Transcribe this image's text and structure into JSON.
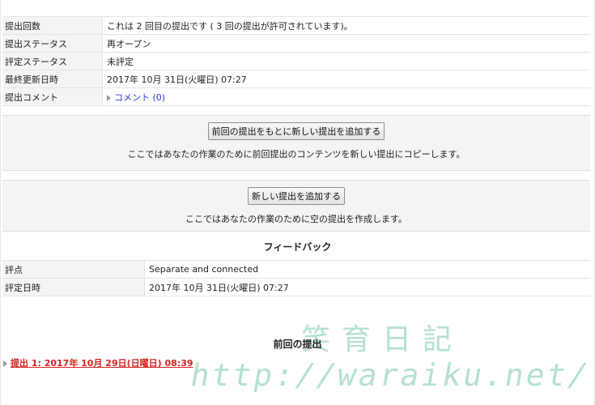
{
  "status_table": {
    "rows": [
      {
        "label": "提出回数",
        "value": "これは 2 回目の提出です ( 3 回の提出が許可されています)。"
      },
      {
        "label": "提出ステータス",
        "value": "再オープン"
      },
      {
        "label": "評定ステータス",
        "value": "未評定"
      },
      {
        "label": "最終更新日時",
        "value": "2017年 10月 31日(火曜日) 07:27"
      },
      {
        "label": "提出コメント",
        "value": "コメント (0)"
      }
    ]
  },
  "actions": {
    "copy_previous": {
      "button": "前回の提出をもとに新しい提出を追加する",
      "description": "ここではあなたの作業のために前回提出のコンテンツを新しい提出にコピーします。"
    },
    "new_blank": {
      "button": "新しい提出を追加する",
      "description": "ここではあなたの作業のために空の提出を作成します。"
    }
  },
  "feedback": {
    "title": "フィードバック",
    "rows": [
      {
        "label": "評点",
        "value": "Separate and connected"
      },
      {
        "label": "評定日時",
        "value": "2017年 10月 31日(火曜日) 07:27"
      }
    ]
  },
  "previous": {
    "title": "前回の提出",
    "link": "提出 1: 2017年 10月 29日(日曜日) 08:39"
  },
  "watermark": {
    "title": "笑育日記",
    "url": "http://waraiku.net/"
  },
  "colors": {
    "link_blue": "#2b3bd0",
    "link_red": "#d62222",
    "label_bg": "#f4f4f4",
    "watermark": "#78c8a5"
  }
}
